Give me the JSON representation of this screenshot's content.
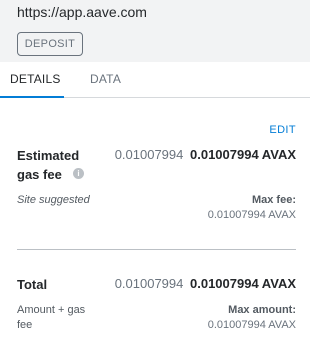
{
  "header": {
    "origin": "https://app.aave.com",
    "method_button_label": "DEPOSIT"
  },
  "tabs": [
    {
      "label": "DETAILS",
      "active": true
    },
    {
      "label": "DATA",
      "active": false
    }
  ],
  "edit_label": "EDIT",
  "gas_fee": {
    "label": "Estimated gas fee",
    "secondary_value": "0.01007994",
    "primary_value": "0.01007994 AVAX",
    "subtext": "Site suggested",
    "max_label": "Max fee:",
    "max_value": "0.01007994 AVAX"
  },
  "total": {
    "label": "Total",
    "secondary_value": "0.01007994",
    "primary_value": "0.01007994 AVAX",
    "subtext": "Amount + gas fee",
    "max_label": "Max amount:",
    "max_value": "0.01007994 AVAX"
  },
  "colors": {
    "accent": "#037dd6",
    "header_bg": "#f2f3f4",
    "muted_text": "#6a737d"
  },
  "icons": {
    "info": "info-icon"
  }
}
